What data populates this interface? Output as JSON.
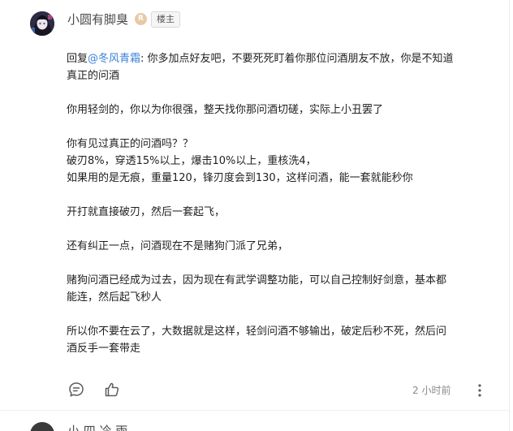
{
  "comment": {
    "author": "小圆有脚臭",
    "level_badge": "R",
    "op_badge": "楼主",
    "reply_prefix": "回复",
    "mention": "@冬风青霜",
    "reply_text_line1": ": 你多加点好友吧，不要死死盯着你那位问酒朋友不放，你是不知道",
    "reply_text_line2": "真正的问酒",
    "paragraph_2": "你用轻剑的，你以为你很强，整天找你那问酒切磋，实际上小丑罢了",
    "paragraph_3_line1": "你有见过真正的问酒吗？？",
    "paragraph_3_line2": "破刃8%，穿透15%以上，爆击10%以上，重核洗4，",
    "paragraph_3_line3": "如果用的是无痕，重量120，锋刃度会到130，这样问酒，能一套就能秒你",
    "paragraph_4": "开打就直接破刃，然后一套起飞，",
    "paragraph_5": "还有纠正一点，问酒现在不是赌狗门派了兄弟，",
    "paragraph_6_line1": "赌狗问酒已经成为过去，因为现在有武学调整功能，可以自己控制好剑意，基本都",
    "paragraph_6_line2": "能连，然后起飞秒人",
    "paragraph_7_line1": "所以你不要在云了，大数据就是这样，轻剑问酒不够输出，破定后秒不死，然后问",
    "paragraph_7_line2": "酒反手一套带走",
    "timestamp": "2 小时前"
  },
  "icons": {
    "reply": "comment-bubble-icon",
    "like": "thumbs-up-icon",
    "more": "more-options-icon"
  },
  "next_comment": {
    "author": "小 四 冷  雨"
  },
  "colors": {
    "mention": "#3a7fd8",
    "text": "#1f1f1f",
    "muted": "#8a8a8a"
  }
}
